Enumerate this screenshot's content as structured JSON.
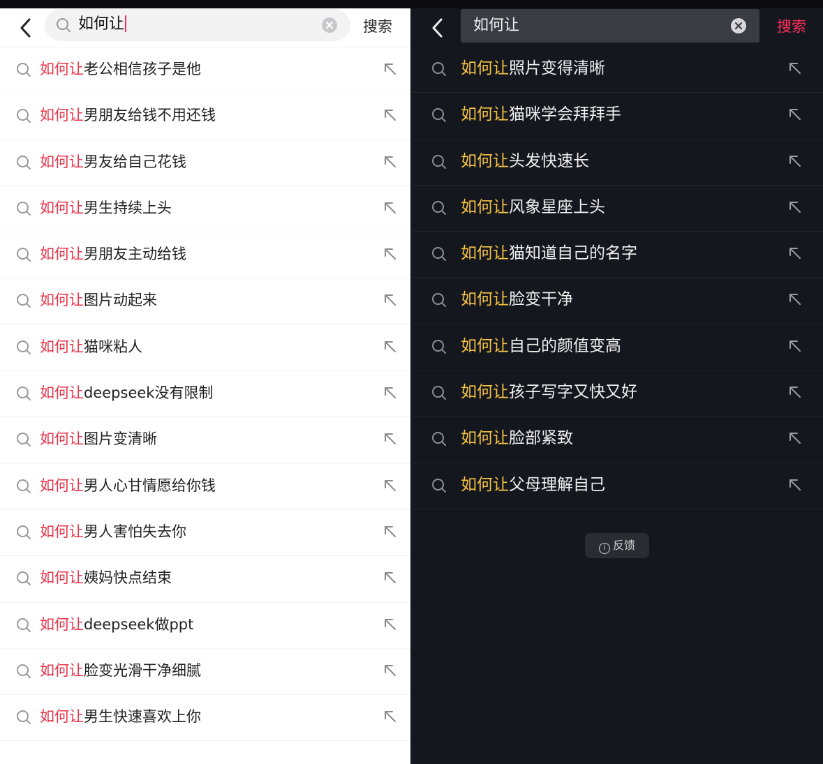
{
  "left": {
    "query": "如何让",
    "search_button": "搜索",
    "highlight": "如何让",
    "suggestions": [
      "老公相信孩子是他",
      "男朋友给钱不用还钱",
      "男友给自己花钱",
      "男生持续上头",
      "男朋友主动给钱",
      "图片动起来",
      "猫咪粘人",
      "deepseek没有限制",
      "图片变清晰",
      "男人心甘情愿给你钱",
      "男人害怕失去你",
      "姨妈快点结束",
      "deepseek做ppt",
      "脸变光滑干净细腻",
      "男生快速喜欢上你"
    ]
  },
  "right": {
    "query": "如何让",
    "search_button": "搜索",
    "highlight": "如何让",
    "suggestions": [
      "照片变得清晰",
      "猫咪学会拜拜手",
      "头发快速长",
      "风象星座上头",
      "猫知道自己的名字",
      "脸变干净",
      "自己的颜值变高",
      "孩子写字又快又好",
      "脸部紧致",
      "父母理解自己"
    ],
    "feedback_label": "反馈"
  },
  "icons": {
    "back": "chevron-left-icon",
    "search": "search-icon",
    "clear": "clear-icon",
    "fill": "arrow-up-left-icon",
    "info": "info-icon"
  },
  "colors": {
    "left_highlight": "#e8344a",
    "right_highlight": "#f5c344",
    "right_search_button": "#ff2f5a"
  }
}
